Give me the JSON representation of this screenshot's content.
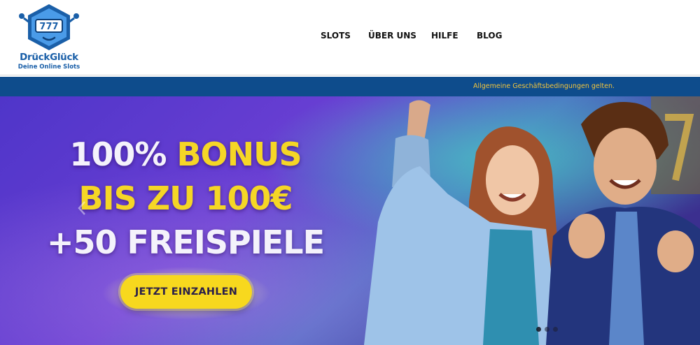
{
  "brand": {
    "name": "DrückGlück",
    "tagline": "Deine Online Slots",
    "logo_reels": "777",
    "primary_color": "#1a5fa8",
    "accent_color": "#4a9be8"
  },
  "nav": {
    "items": [
      {
        "label": "SLOTS"
      },
      {
        "label": "ÜBER UNS"
      },
      {
        "label": "HILFE"
      },
      {
        "label": "BLOG"
      }
    ]
  },
  "topbar": {
    "terms_text": "Allgemeine Geschäftsbedingungen gelten.",
    "background": "#0e4c8c",
    "text_color": "#f2c53d"
  },
  "hero": {
    "line1_a": "100% ",
    "line1_b": "BONUS",
    "line2": "BIS ZU 100€",
    "line3": "+50 FREISPIELE",
    "cta_label": "JETZT EINZAHLEN",
    "highlight_color": "#f5d626",
    "background_color": "#5a34c8",
    "slides_total": 3,
    "slide_active": 1
  }
}
